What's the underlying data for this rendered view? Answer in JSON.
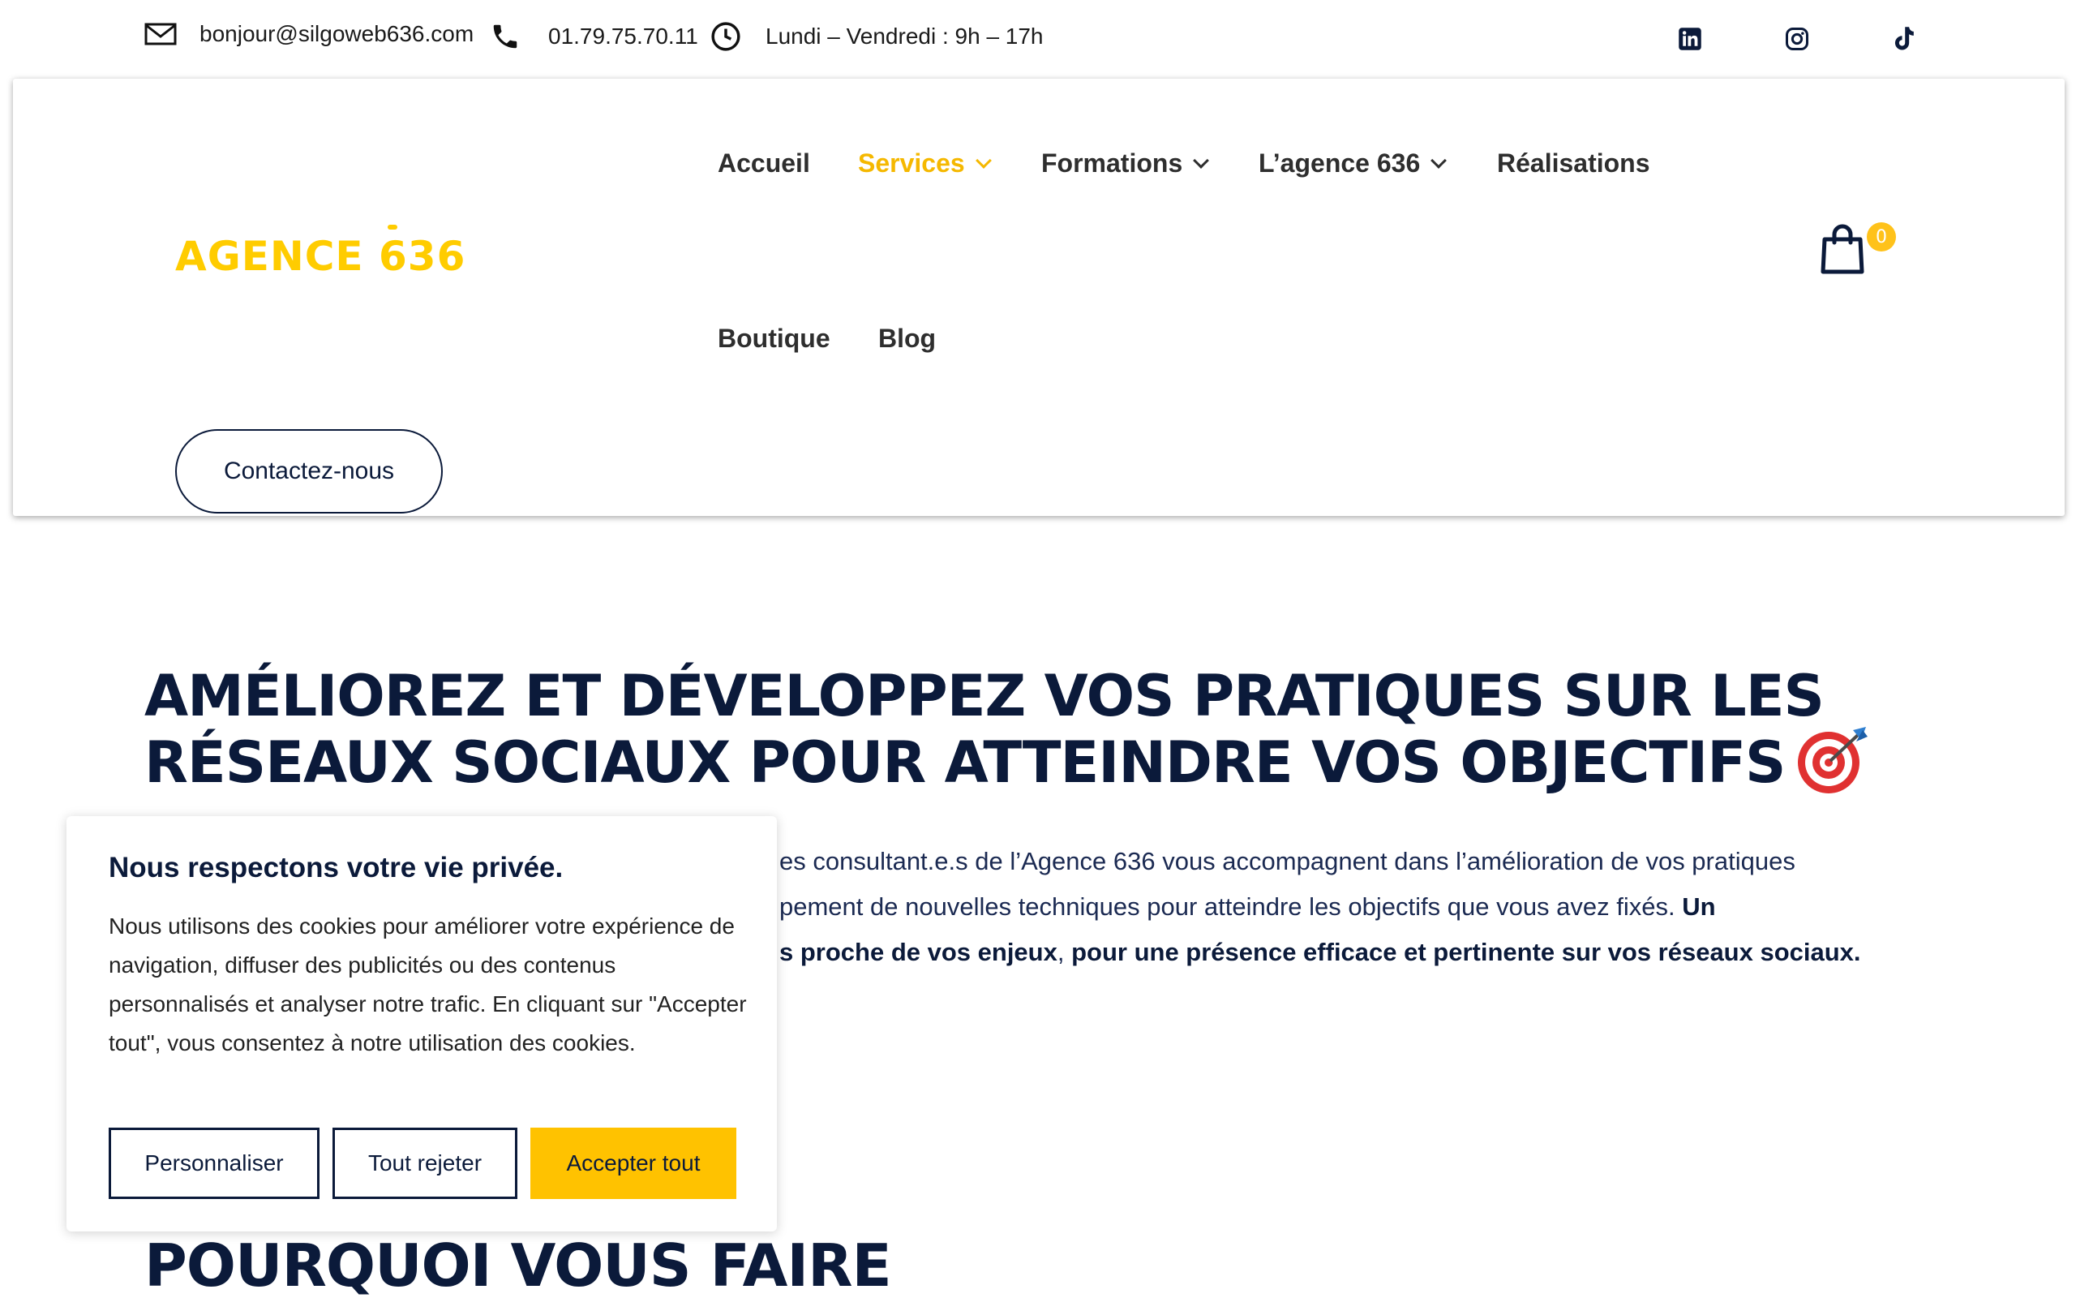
{
  "topbar": {
    "email": "bonjour@silgoweb636.com",
    "phone": "01.79.75.70.11",
    "hours": "Lundi – Vendredi : 9h – 17h"
  },
  "header": {
    "logo": "AGENCE 636",
    "nav": [
      {
        "label": "Accueil"
      },
      {
        "label": "Services"
      },
      {
        "label": "Formations"
      },
      {
        "label": "L’agence 636"
      },
      {
        "label": "Réalisations"
      },
      {
        "label": "Boutique"
      },
      {
        "label": "Blog"
      }
    ],
    "cart_count": "0",
    "contact_label": "Contactez-nous"
  },
  "main": {
    "title_line1": "AMÉLIOREZ ET DÉVELOPPEZ VOS PRATIQUES SUR LES",
    "title_line2": "RÉSEAUX SOCIAUX POUR ATTEINDRE VOS OBJECTIFS",
    "para_line1": "es consultant.e.s de l’Agence 636 vous accompagnent dans l’amélioration de vos pratiques",
    "para_line2": "pement de nouvelles techniques pour atteindre les objectifs que vous avez fixés. ",
    "para_line2_bold": "Un",
    "para_line3_bold_a": "s proche de vos enjeux",
    "para_line3_sep": ", ",
    "para_line3_bold_b": "pour une présence efficace et pertinente sur vos réseaux sociaux.",
    "section_title": "POURQUOI VOUS FAIRE"
  },
  "cookie": {
    "title": "Nous respectons votre vie privée.",
    "text": "Nous utilisons des cookies pour améliorer votre expérience de navigation, diffuser des publicités ou des contenus personnalisés et analyser notre trafic. En cliquant sur \"Accepter tout\", vous consentez à notre utilisation des cookies.",
    "customize_label": "Personnaliser",
    "reject_label": "Tout rejeter",
    "accept_label": "Accepter tout"
  },
  "colors": {
    "accent": "#ffc200",
    "navy": "#0b1a3a"
  },
  "icons": [
    "mail-icon",
    "phone-icon",
    "clock-icon",
    "linkedin-icon",
    "instagram-icon",
    "tiktok-icon",
    "shopping-bag-icon",
    "target-icon"
  ]
}
